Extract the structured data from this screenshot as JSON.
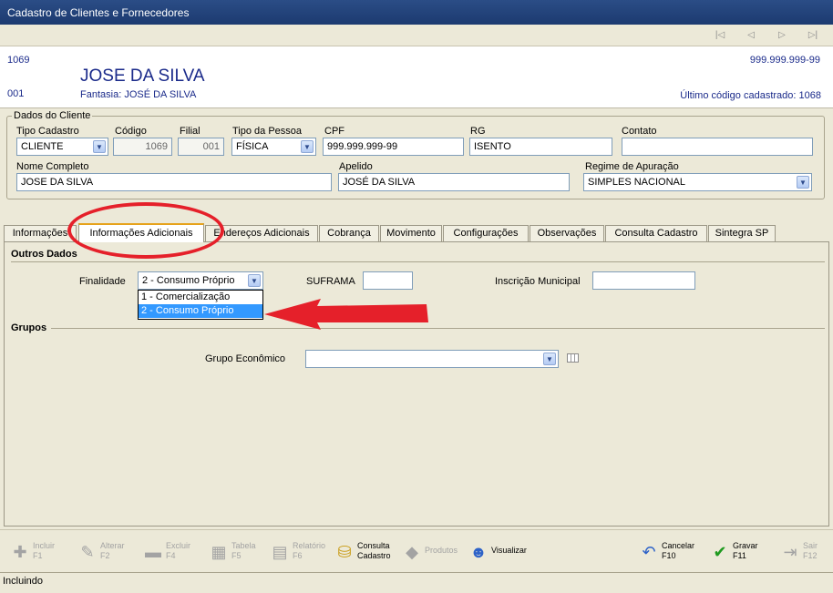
{
  "window": {
    "title": "Cadastro de Clientes e Fornecedores"
  },
  "nav": {
    "first_icon": "first-record-icon",
    "prev_icon": "prev-record-icon",
    "next_icon": "next-record-icon",
    "last_icon": "last-record-icon"
  },
  "header": {
    "codigo": "1069",
    "filial": "001",
    "nome": "JOSE DA SILVA",
    "fantasia_label": "Fantasia:",
    "fantasia": "JOSÉ DA SILVA",
    "cpf": "999.999.999-99",
    "ultimo_codigo": "Último código cadastrado: 1068"
  },
  "dados_cliente": {
    "legend": "Dados do Cliente",
    "tipo_cadastro": {
      "label": "Tipo Cadastro",
      "value": "CLIENTE"
    },
    "codigo": {
      "label": "Código",
      "value": "1069"
    },
    "filial": {
      "label": "Filial",
      "value": "001"
    },
    "tipo_pessoa": {
      "label": "Tipo da Pessoa",
      "value": "FÍSICA"
    },
    "cpf": {
      "label": "CPF",
      "value": "999.999.999-99"
    },
    "rg": {
      "label": "RG",
      "value": "ISENTO"
    },
    "contato": {
      "label": "Contato",
      "value": ""
    },
    "nome_completo": {
      "label": "Nome Completo",
      "value": "JOSE DA SILVA"
    },
    "apelido": {
      "label": "Apelido",
      "value": "JOSÉ DA SILVA"
    },
    "regime": {
      "label": "Regime de Apuração",
      "value": "SIMPLES NACIONAL"
    }
  },
  "tabs": [
    {
      "label": "Informações"
    },
    {
      "label": "Informações Adicionais"
    },
    {
      "label": "Endereços Adicionais"
    },
    {
      "label": "Cobrança"
    },
    {
      "label": "Movimento"
    },
    {
      "label": "Configurações"
    },
    {
      "label": "Observações"
    },
    {
      "label": "Consulta Cadastro"
    },
    {
      "label": "Sintegra SP"
    }
  ],
  "outros_dados": {
    "title": "Outros Dados",
    "finalidade": {
      "label": "Finalidade",
      "value": "2 - Consumo Próprio",
      "options": [
        "1 - Comercialização",
        "2 - Consumo Próprio"
      ]
    },
    "suframa": {
      "label": "SUFRAMA",
      "value": ""
    },
    "inscricao_municipal": {
      "label": "Inscrição Municipal",
      "value": ""
    }
  },
  "grupos": {
    "title": "Grupos",
    "grupo_economico": {
      "label": "Grupo Econômico",
      "value": ""
    }
  },
  "toolbar": {
    "incluir": "Incluir\nF1",
    "alterar": "Alterar\nF2",
    "excluir": "Excluir\nF4",
    "tabela": "Tabela\nF5",
    "relatorio": "Relatório\nF6",
    "consulta": "Consulta\nCadastro",
    "produtos": "Produtos",
    "visualizar": "Visualizar",
    "cancelar": "Cancelar\nF10",
    "gravar": "Gravar\nF11",
    "sair": "Sair\nF12"
  },
  "status": {
    "text": "Incluindo"
  },
  "colors": {
    "accent_red": "#e5202a",
    "title_blue": "#1a2a8a",
    "selection": "#3399ff"
  }
}
